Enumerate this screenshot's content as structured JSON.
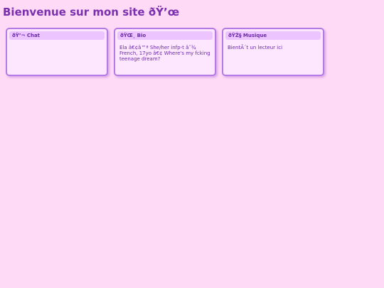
{
  "page": {
    "title": "Bienvenue sur mon site ðŸ’œ"
  },
  "cards": [
    {
      "title": "ðŸ’¬ Chat",
      "body": ""
    },
    {
      "title": "ðŸŒ¸ Bio",
      "body": "Ela â€¢â™ª She/her infp-t â˜¾ French, 17yo â€¢ Where's my fcking teenage dream?"
    },
    {
      "title": "ðŸŽ§ Musique",
      "body": "BientÃ´t un lecteur ici"
    }
  ],
  "colors": {
    "background": "#ffdaf6",
    "card_background": "#fde7ff",
    "card_border": "#b47ae6",
    "card_header": "#ecc4ff",
    "text": "#6a2aa8"
  }
}
